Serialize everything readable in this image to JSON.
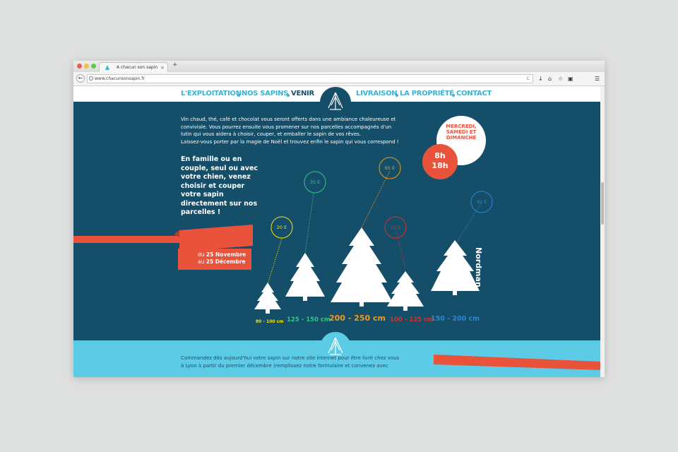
{
  "browser": {
    "tab_title": "A chacun son sapin",
    "tab_close": "×",
    "new_tab": "+",
    "url": "www.chacunsonsapin.fr",
    "url_reload": "C",
    "back": "←",
    "tools": [
      "↓",
      "⌂",
      "☆",
      "▣",
      "☰"
    ]
  },
  "nav": {
    "items": [
      {
        "label": "L'EXPLOITATION",
        "active": false
      },
      {
        "label": "NOS SAPINS",
        "active": false
      },
      {
        "label": "VENIR",
        "active": true
      },
      {
        "label": "LIVRAISON",
        "active": false
      },
      {
        "label": "LA PROPRIÉTÉ",
        "active": false
      },
      {
        "label": "CONTACT",
        "active": false
      }
    ]
  },
  "intro": {
    "line1": "Vin chaud, thé, café et chocolat vous seront offerts dans une ambiance chaleureuse et",
    "line2": "conviviale. Vous pourrez ensuite vous promener sur nos parcelles accompagnés d'un",
    "line3": "lutin qui vous aidera à choisir, couper, et emballer le sapin de vos rêves.",
    "line4": "Laissez-vous porter par la magie de Noël et trouvez enfin le sapin qui vous correspond !"
  },
  "highlight": {
    "text": "En famille ou en couple, seul ou avec votre chien, venez choisir et couper votre sapin directement sur nos parcelles !"
  },
  "schedule": {
    "line1": "MERCREDI,",
    "line2": "SAMEDI ET",
    "line3": "DIMANCHE",
    "hour_start": "8h",
    "hour_end": "18h"
  },
  "dates": {
    "from_prefix": "du",
    "from": "25 Novembre",
    "to_prefix": "au",
    "to": "25 Décembre"
  },
  "trees": [
    {
      "size": "80 - 100 cm",
      "price": "20 E",
      "color": "#f3e11a"
    },
    {
      "size": "125 - 150 cm",
      "price": "35 E",
      "color": "#36c48b"
    },
    {
      "size": "200 - 250 cm",
      "price": "65 E",
      "color": "#f39a1c"
    },
    {
      "size": "100 - 125 cm",
      "price": "25 E",
      "color": "#d6302b"
    },
    {
      "size": "150 - 200 cm",
      "price": "45 E",
      "color": "#2a86d6"
    }
  ],
  "variety": "Nordman",
  "footer": {
    "line1": "Commandez dès aujourd'hui votre sapin sur notre site internet pour être livré chez vous",
    "line2": "à Lyon à partir du premier décembre (remplissez notre formulaire et convenez avec"
  },
  "colors": {
    "page_bg": "#154e69",
    "accent": "#3cb3d3",
    "ribbon": "#e9533b",
    "footer_band": "#5bcbe6"
  }
}
